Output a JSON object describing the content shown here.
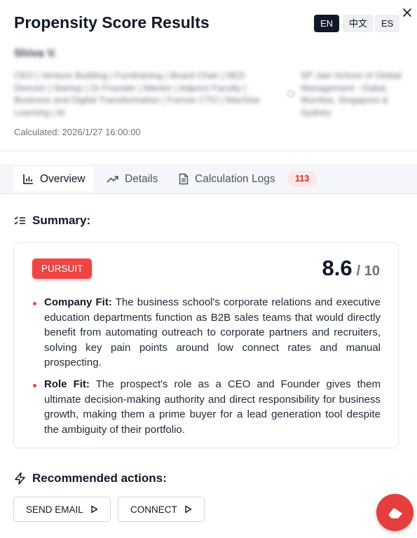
{
  "header": {
    "title": "Propensity Score Results",
    "languages": [
      "EN",
      "中文",
      "ES"
    ],
    "active_language": "EN",
    "close_icon": "close-icon"
  },
  "profile": {
    "name": "Shiva V.",
    "headline": "CEO | Venture Building | Fundraising | Board Chair | NED Director | Startup | 2x Founder | Mentor | Adjunct Faculty | Business and Digital Transformation | Former CTO | Machine Learning | AI",
    "company": "SP Jain School of Global Management - Dubai, Mumbai, Singapore & Sydney",
    "calculated": "Calculated: 2026/1/27 16:00:00"
  },
  "tabs": [
    {
      "label": "Overview",
      "icon": "bar-chart-icon"
    },
    {
      "label": "Details",
      "icon": "trending-up-icon"
    },
    {
      "label": "Calculation Logs",
      "icon": "file-text-icon"
    }
  ],
  "logs_count": "113",
  "summary": {
    "title": "Summary:",
    "verdict": "PURSUIT",
    "score": "8.6",
    "score_max": "/ 10",
    "bullets": [
      {
        "label": "Company Fit:",
        "text": "The business school's corporate relations and executive education departments function as B2B sales teams that would directly benefit from automating outreach to corporate partners and recruiters, solving key pain points around low connect rates and manual prospecting."
      },
      {
        "label": "Role Fit:",
        "text": "The prospect's role as a CEO and Founder gives them ultimate decision-making authority and direct responsibility for business growth, making them a prime buyer for a lead generation tool despite the ambiguity of their portfolio."
      }
    ]
  },
  "actions": {
    "title": "Recommended actions:",
    "send_email": "SEND EMAIL",
    "connect": "CONNECT"
  },
  "colors": {
    "accent": "#ef4444",
    "dark": "#111827"
  }
}
